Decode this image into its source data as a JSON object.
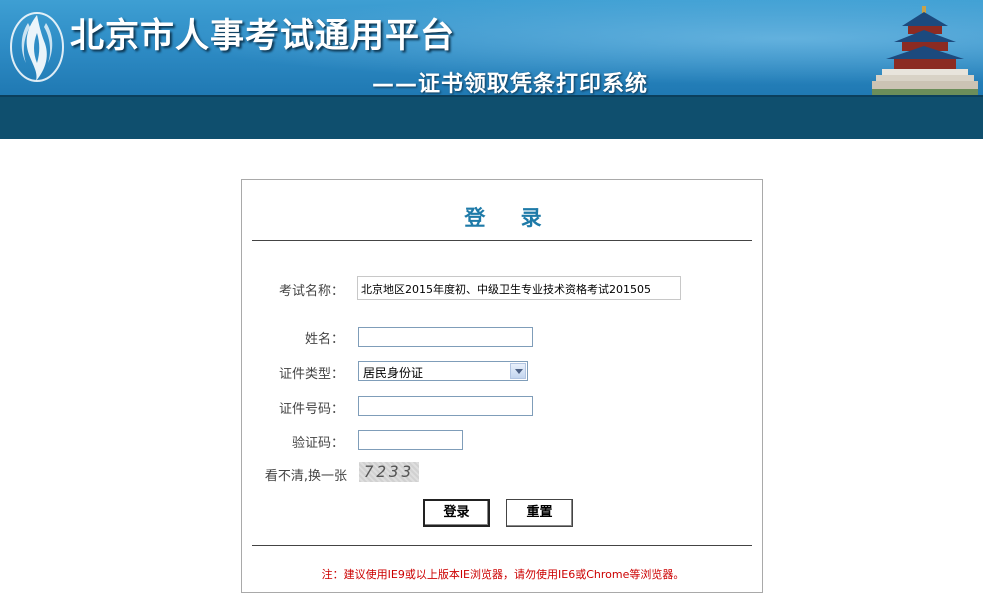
{
  "header": {
    "title": "北京市人事考试通用平台",
    "subtitle": "——证书领取凭条打印系统",
    "logo_icon": "flame-logo-icon",
    "temple_icon": "temple-of-heaven-icon"
  },
  "login": {
    "title": "登 录",
    "exam_name": {
      "label": "考试名称：",
      "value": "北京地区2015年度初、中级卫生专业技术资格考试201505"
    },
    "name": {
      "label": "姓名：",
      "value": ""
    },
    "id_type": {
      "label": "证件类型：",
      "selected": "居民身份证"
    },
    "id_number": {
      "label": "证件号码：",
      "value": ""
    },
    "captcha": {
      "label": "验证码：",
      "value": ""
    },
    "refresh": {
      "label": "看不清,换一张",
      "code": "7233"
    },
    "buttons": {
      "login": "登录",
      "reset": "重置"
    },
    "note": "注：建议使用IE9或以上版本IE浏览器，请勿使用IE6或Chrome等浏览器。"
  },
  "colors": {
    "banner": "#2f8dc6",
    "banner_dark": "#0f4f6e",
    "title_accent": "#1e7aa8",
    "note": "#cc0000"
  }
}
